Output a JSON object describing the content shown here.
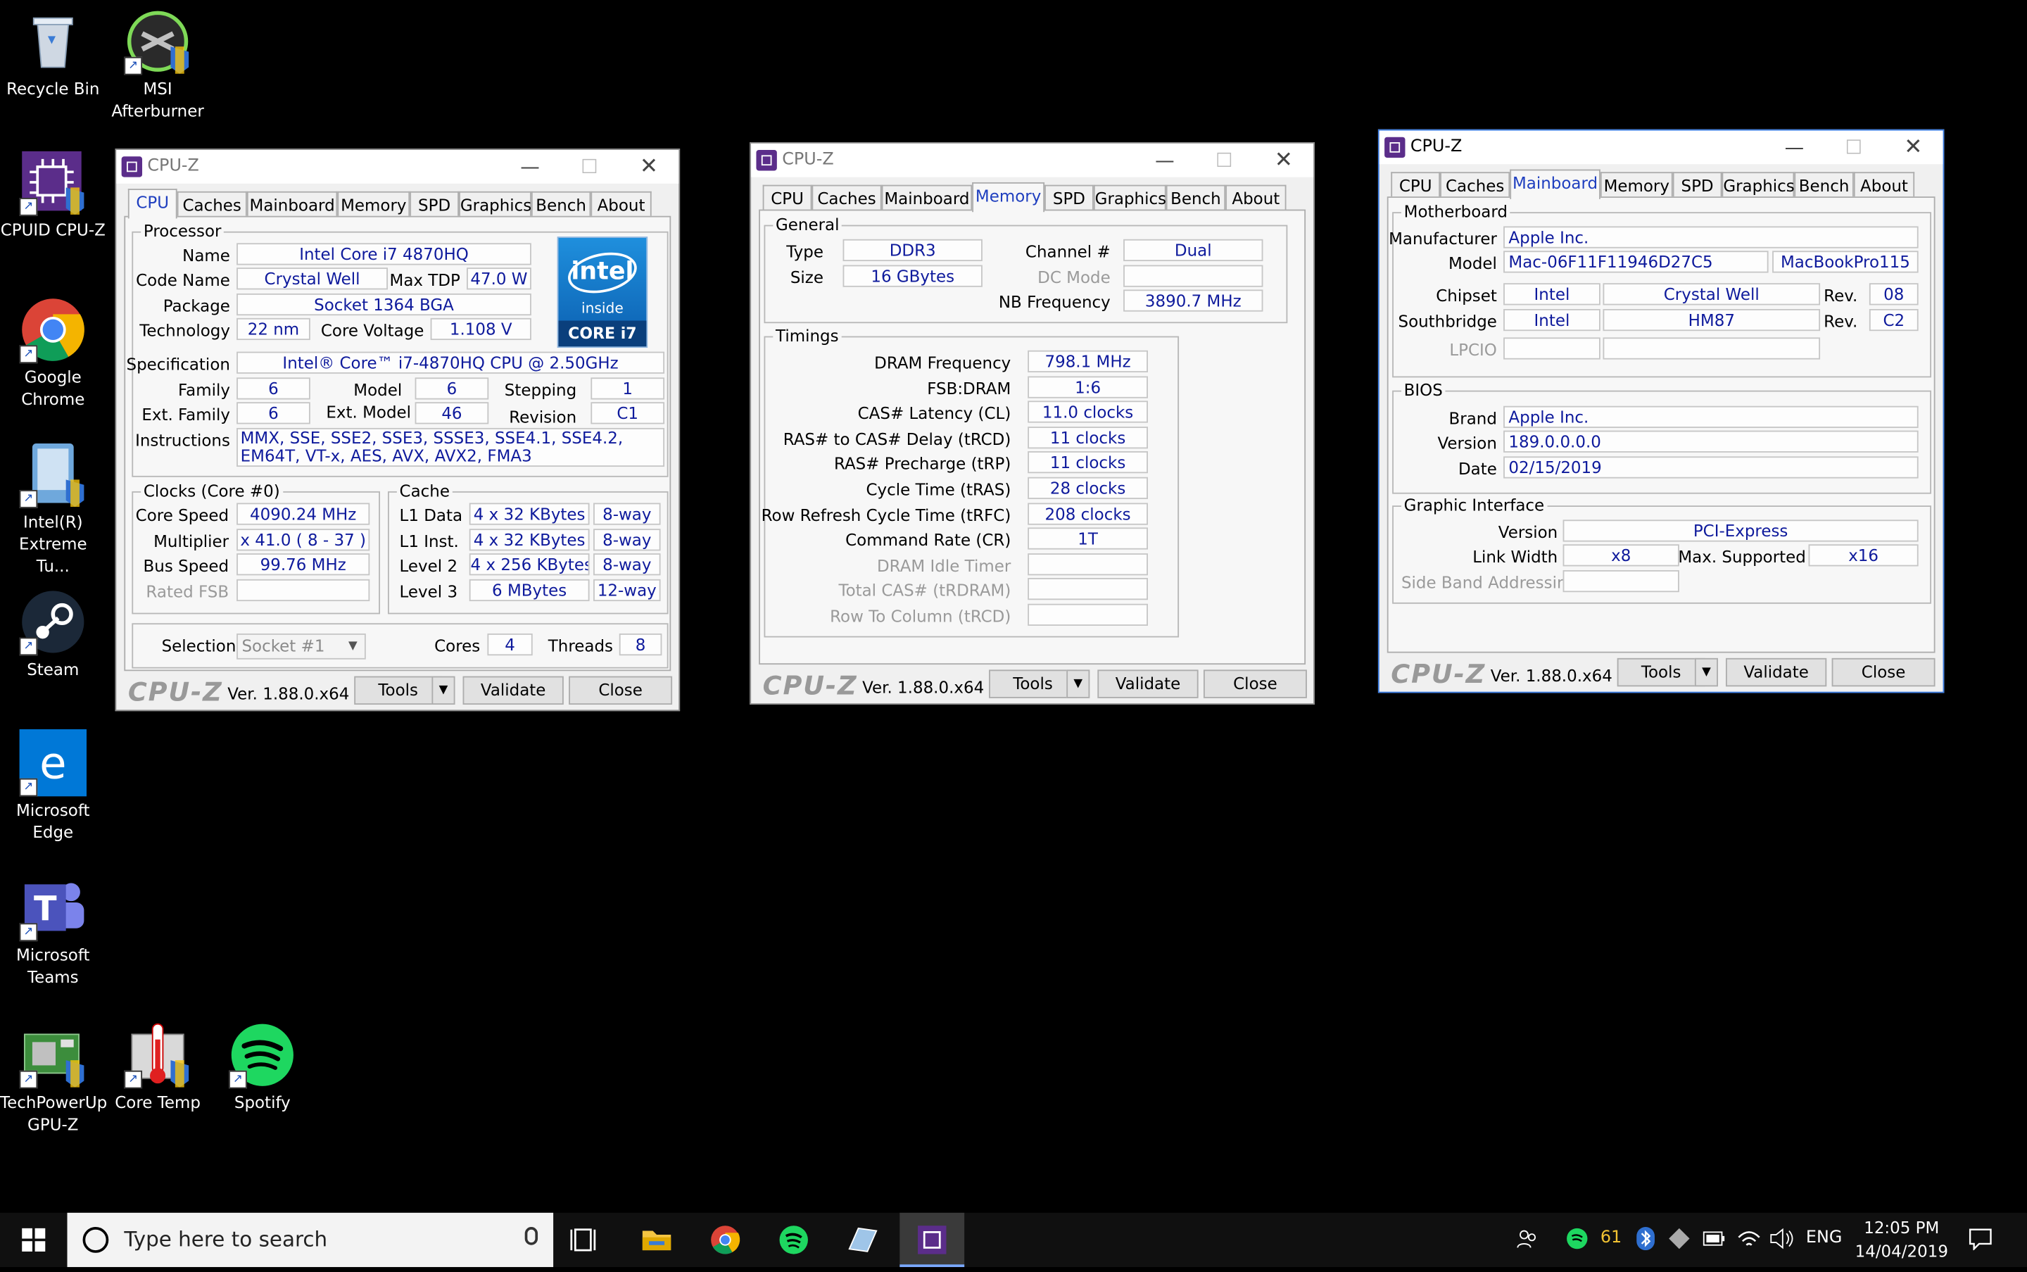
{
  "desktop": {
    "icons": {
      "recycle_bin": "Recycle Bin",
      "msi_afterburner": "MSI Afterburner",
      "cpuid_cpuz": "CPUID CPU-Z",
      "google_chrome": "Google Chrome",
      "intel_xtu": "Intel(R) Extreme Tu...",
      "steam": "Steam",
      "microsoft_edge": "Microsoft Edge",
      "microsoft_teams": "Microsoft Teams",
      "techpowerup_gpuz": "TechPowerUp GPU-Z",
      "core_temp": "Core Temp",
      "spotify": "Spotify"
    }
  },
  "common": {
    "window_title": "CPU-Z",
    "tabs": [
      "CPU",
      "Caches",
      "Mainboard",
      "Memory",
      "SPD",
      "Graphics",
      "Bench",
      "About"
    ],
    "logo": "CPU-Z",
    "version": "Ver. 1.88.0.x64",
    "tools": "Tools",
    "validate": "Validate",
    "close": "Close"
  },
  "cpu": {
    "processor": {
      "title": "Processor",
      "name_label": "Name",
      "name": "Intel Core i7 4870HQ",
      "codename_label": "Code Name",
      "codename": "Crystal Well",
      "maxtdp_label": "Max TDP",
      "maxtdp": "47.0 W",
      "package_label": "Package",
      "package": "Socket 1364 BGA",
      "technology_label": "Technology",
      "technology": "22 nm",
      "corevoltage_label": "Core Voltage",
      "corevoltage": "1.108 V",
      "spec_label": "Specification",
      "spec": "Intel® Core™ i7-4870HQ CPU @ 2.50GHz",
      "family_label": "Family",
      "family": "6",
      "model_label": "Model",
      "model": "6",
      "stepping_label": "Stepping",
      "stepping": "1",
      "extfamily_label": "Ext. Family",
      "extfamily": "6",
      "extmodel_label": "Ext. Model",
      "extmodel": "46",
      "revision_label": "Revision",
      "revision": "C1",
      "instructions_label": "Instructions",
      "instructions": "MMX, SSE, SSE2, SSE3, SSSE3, SSE4.1, SSE4.2, EM64T, VT-x, AES, AVX, AVX2, FMA3"
    },
    "intel_logo": {
      "brand": "intel",
      "inside": "inside",
      "core": "CORE i7"
    },
    "clocks": {
      "title": "Clocks (Core #0)",
      "corespeed_label": "Core Speed",
      "corespeed": "4090.24 MHz",
      "multiplier_label": "Multiplier",
      "multiplier": "x 41.0 ( 8 - 37 )",
      "busspeed_label": "Bus Speed",
      "busspeed": "99.76 MHz",
      "ratedfsb_label": "Rated FSB"
    },
    "cache": {
      "title": "Cache",
      "l1data_label": "L1 Data",
      "l1data": "4 x 32 KBytes",
      "l1data_way": "8-way",
      "l1inst_label": "L1 Inst.",
      "l1inst": "4 x 32 KBytes",
      "l1inst_way": "8-way",
      "level2_label": "Level 2",
      "level2": "4 x 256 KBytes",
      "level2_way": "8-way",
      "level3_label": "Level 3",
      "level3": "6 MBytes",
      "level3_way": "12-way"
    },
    "selection": {
      "label": "Selection",
      "socket": "Socket #1",
      "cores_label": "Cores",
      "cores": "4",
      "threads_label": "Threads",
      "threads": "8"
    }
  },
  "memory": {
    "general": {
      "title": "General",
      "type_label": "Type",
      "type": "DDR3",
      "size_label": "Size",
      "size": "16 GBytes",
      "channel_label": "Channel #",
      "channel": "Dual",
      "dcmode_label": "DC Mode",
      "nbfreq_label": "NB Frequency",
      "nbfreq": "3890.7 MHz"
    },
    "timings": {
      "title": "Timings",
      "rows": [
        {
          "label": "DRAM Frequency",
          "value": "798.1 MHz",
          "enabled": true
        },
        {
          "label": "FSB:DRAM",
          "value": "1:6",
          "enabled": true
        },
        {
          "label": "CAS# Latency (CL)",
          "value": "11.0 clocks",
          "enabled": true
        },
        {
          "label": "RAS# to CAS# Delay (tRCD)",
          "value": "11 clocks",
          "enabled": true
        },
        {
          "label": "RAS# Precharge (tRP)",
          "value": "11 clocks",
          "enabled": true
        },
        {
          "label": "Cycle Time (tRAS)",
          "value": "28 clocks",
          "enabled": true
        },
        {
          "label": "Row Refresh Cycle Time (tRFC)",
          "value": "208 clocks",
          "enabled": true
        },
        {
          "label": "Command Rate (CR)",
          "value": "1T",
          "enabled": true
        },
        {
          "label": "DRAM Idle Timer",
          "value": "",
          "enabled": false
        },
        {
          "label": "Total CAS# (tRDRAM)",
          "value": "",
          "enabled": false
        },
        {
          "label": "Row To Column (tRCD)",
          "value": "",
          "enabled": false
        }
      ]
    }
  },
  "mainboard": {
    "motherboard": {
      "title": "Motherboard",
      "manufacturer_label": "Manufacturer",
      "manufacturer": "Apple Inc.",
      "model_label": "Model",
      "model": "Mac-06F11F11946D27C5",
      "model2": "MacBookPro115",
      "chipset_label": "Chipset",
      "chipset_vendor": "Intel",
      "chipset_name": "Crystal Well",
      "rev_label": "Rev.",
      "chipset_rev": "08",
      "southbridge_label": "Southbridge",
      "sb_vendor": "Intel",
      "sb_name": "HM87",
      "sb_rev": "C2",
      "lpcio_label": "LPCIO"
    },
    "bios": {
      "title": "BIOS",
      "brand_label": "Brand",
      "brand": "Apple Inc.",
      "version_label": "Version",
      "version": "189.0.0.0.0",
      "date_label": "Date",
      "date": "02/15/2019"
    },
    "graphic": {
      "title": "Graphic Interface",
      "version_label": "Version",
      "version": "PCI-Express",
      "linkwidth_label": "Link Width",
      "linkwidth": "x8",
      "maxsupported_label": "Max. Supported",
      "maxsupported": "x16",
      "sideband_label": "Side Band Addressing"
    }
  },
  "taskbar": {
    "search_placeholder": "Type here to search",
    "tray_badge": "61",
    "language": "ENG",
    "time": "12:05 PM",
    "date": "14/04/2019"
  },
  "colors": {
    "value_text": "#0e1a9c",
    "selected_tab": "#1f3fbf",
    "desktop": "#000000",
    "active_border": "#3a7be0"
  }
}
